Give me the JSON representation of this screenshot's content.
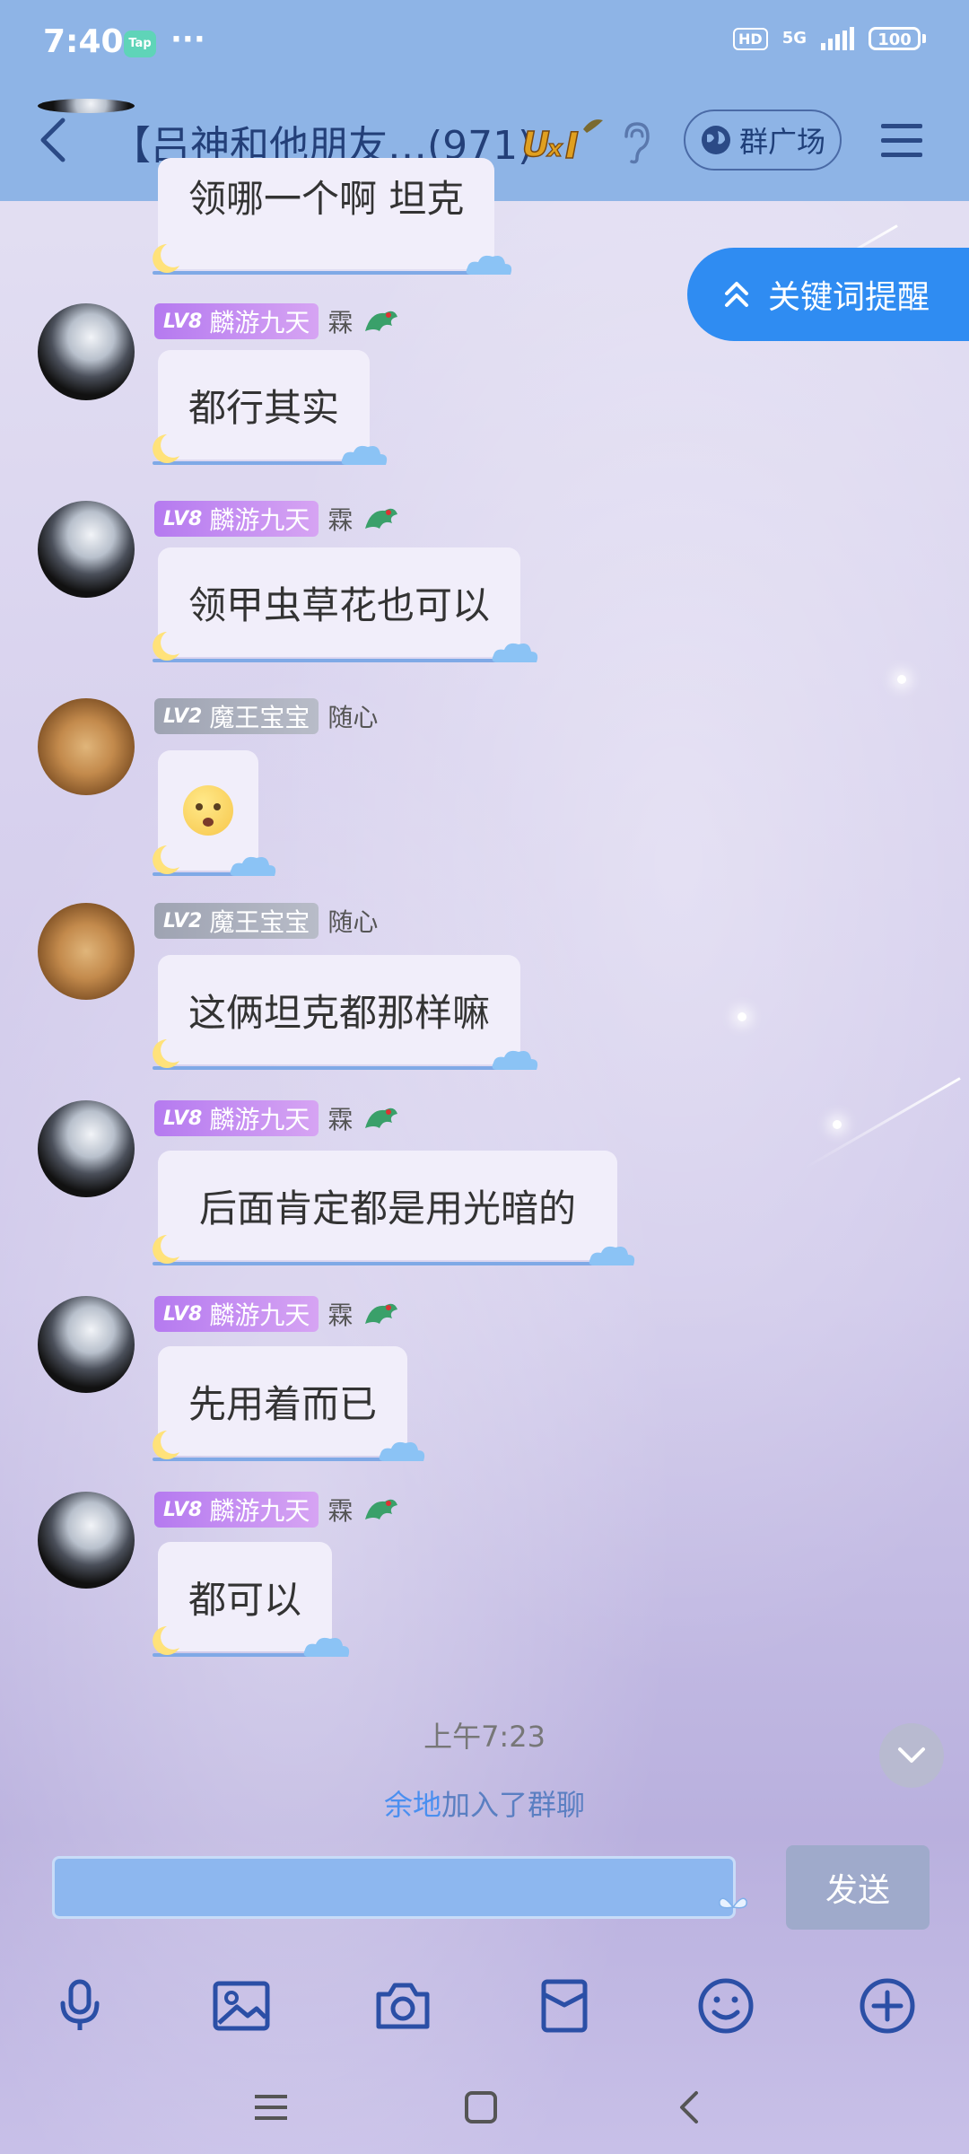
{
  "status_bar": {
    "time": "7:40",
    "app_badge": "Tap",
    "more_dots": "···",
    "hd": "HD",
    "network": "5G",
    "battery": "100"
  },
  "header": {
    "title": "【吕神和他朋友…(971)",
    "square_label": "群广场"
  },
  "keyword_reminder": "关键词提醒",
  "messages": [
    {
      "level": "LV8",
      "name": "麟游九天",
      "title": "霖",
      "text": "领哪一个啊 坦克"
    },
    {
      "level": "LV8",
      "name": "麟游九天",
      "title": "霖",
      "text": "都行其实"
    },
    {
      "level": "LV8",
      "name": "麟游九天",
      "title": "霖",
      "text": "领甲虫草花也可以"
    },
    {
      "level": "LV2",
      "name": "魔王宝宝",
      "title": "随心",
      "text": ""
    },
    {
      "level": "LV2",
      "name": "魔王宝宝",
      "title": "随心",
      "text": "这俩坦克都那样嘛"
    },
    {
      "level": "LV8",
      "name": "麟游九天",
      "title": "霖",
      "text": "后面肯定都是用光暗的"
    },
    {
      "level": "LV8",
      "name": "麟游九天",
      "title": "霖",
      "text": "先用着而已"
    },
    {
      "level": "LV8",
      "name": "麟游九天",
      "title": "霖",
      "text": "都可以"
    }
  ],
  "time_label": "上午7:23",
  "join_notice": {
    "name": "余地",
    "text": "加入了群聊"
  },
  "input": {
    "value": ""
  },
  "send_label": "发送",
  "colors": {
    "header_bg": "#8eb4e6",
    "accent_blue": "#2f8cf2",
    "bubble_bg": "#f1eefa"
  }
}
